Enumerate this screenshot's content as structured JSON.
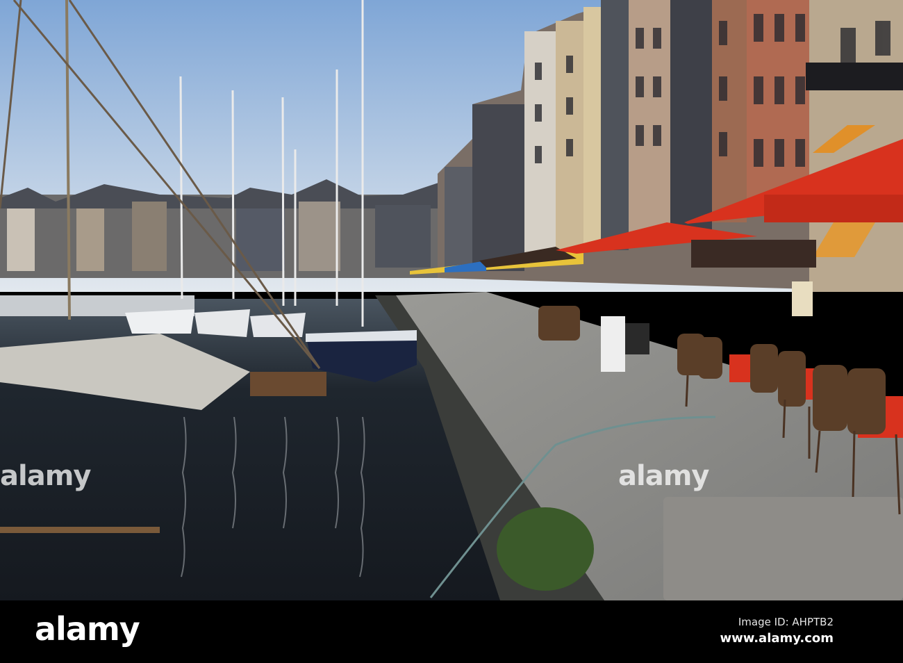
{
  "photo": {
    "subject": "harbour",
    "watermark_text": "alamy",
    "colors": {
      "sky_top": "#7fa6d6",
      "sky_bottom": "#dfe7ee",
      "water": "#1d232b",
      "pavement": "#8a8a88",
      "awning_red": "#d8321e"
    }
  },
  "footer": {
    "logo": "alamy",
    "image_id": "Image ID: AHPTB2",
    "website": "www.alamy.com"
  }
}
